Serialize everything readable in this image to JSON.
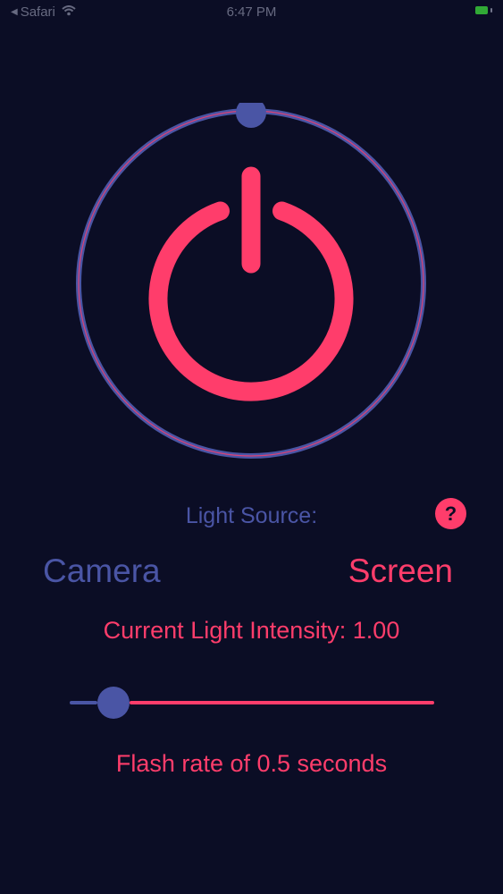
{
  "status_bar": {
    "back_label": "Safari",
    "time": "6:47 PM"
  },
  "power_button": {
    "state": "on",
    "ring_color": "#4a55a5",
    "icon_color": "#ff3d6b",
    "knob_color": "#4a55a5"
  },
  "light_source": {
    "label": "Light Source:",
    "help_label": "?",
    "options": [
      "Camera",
      "Screen"
    ],
    "selected": "Screen"
  },
  "intensity": {
    "label": "Current Light Intensity: 1.00"
  },
  "flash_slider": {
    "fraction": 0.12
  },
  "flash": {
    "label": "Flash rate of 0.5 seconds"
  },
  "colors": {
    "background": "#0b0d25",
    "accent_pink": "#ff3d6b",
    "accent_blue": "#4a55a5"
  },
  "icons": {
    "back": "back-arrow-icon",
    "wifi": "wifi-icon",
    "battery": "battery-icon",
    "power": "power-icon",
    "help": "question-icon"
  }
}
